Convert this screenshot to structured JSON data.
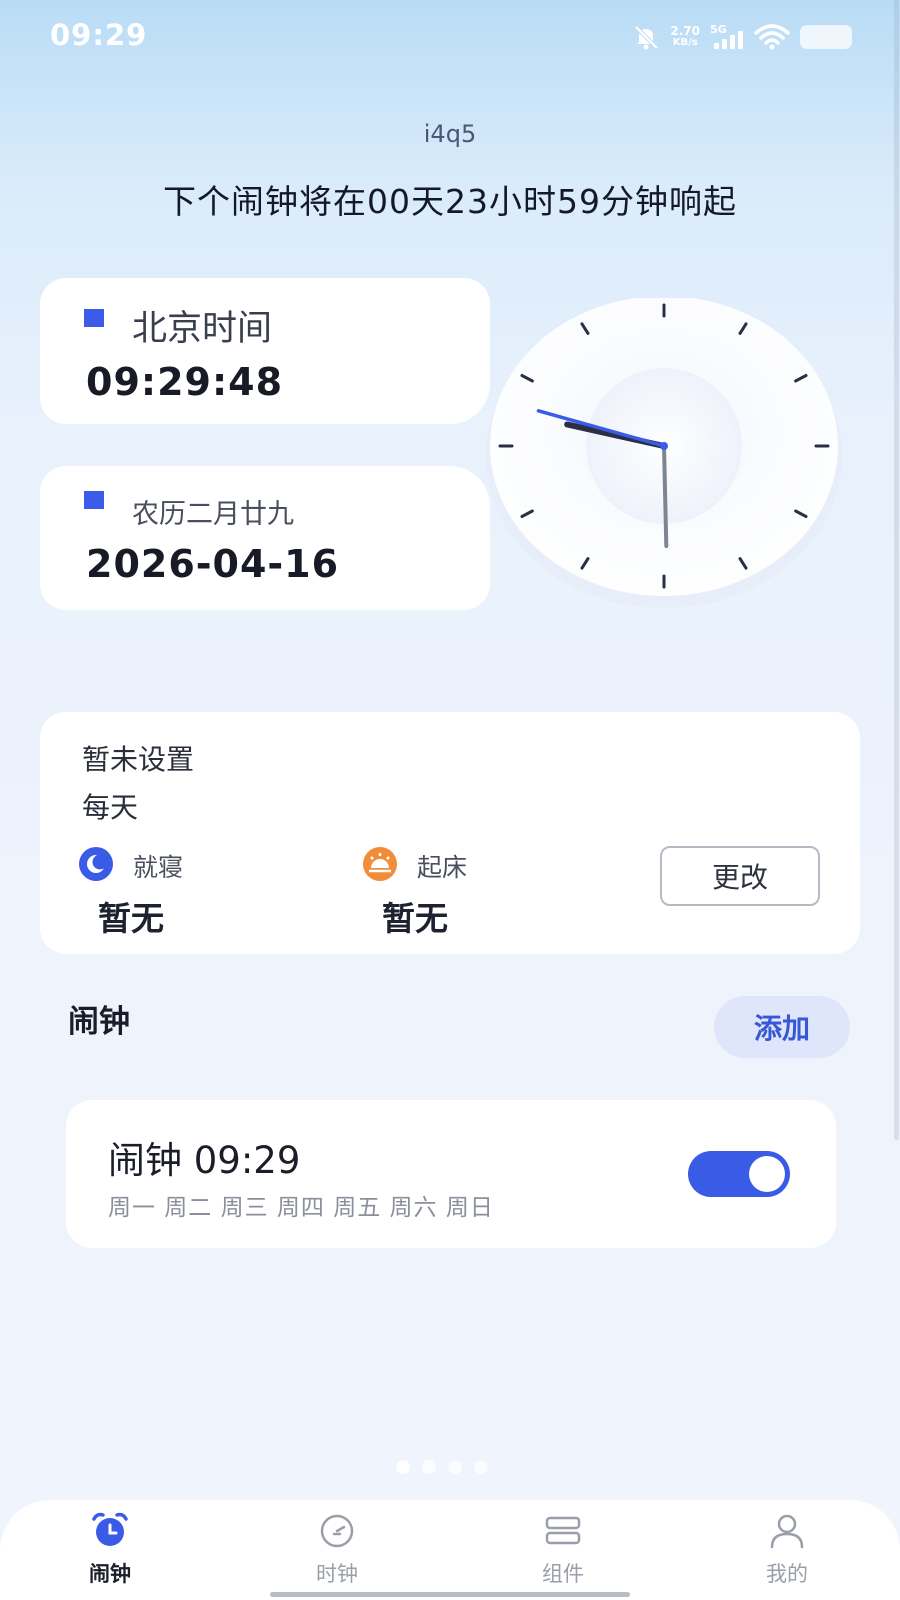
{
  "status_bar": {
    "time": "09:29",
    "net_speed_value": "2.70",
    "net_speed_unit": "KB/s",
    "network_type": "5G",
    "icons": [
      "mute-bell-icon",
      "signal-icon",
      "wifi-icon",
      "battery-icon"
    ]
  },
  "header": {
    "app_id": "i4q5",
    "next_alarm_text": "下个闹钟将在00天23小时59分钟响起"
  },
  "time_card": {
    "label": "北京时间",
    "value": "09:29:48"
  },
  "date_card": {
    "label": "农历二月廿九",
    "value": "2026-04-16"
  },
  "analog_clock": {
    "hours": 9,
    "minutes": 29,
    "seconds": 48
  },
  "sleep_card": {
    "title": "暂未设置",
    "repeat": "每天",
    "bedtime_label": "就寝",
    "bedtime_value": "暂无",
    "wake_label": "起床",
    "wake_value": "暂无",
    "change_button": "更改"
  },
  "alarms_section": {
    "title": "闹钟",
    "add_button": "添加",
    "items": [
      {
        "title": "闹钟 09:29",
        "days": "周一 周二 周三 周四 周五 周六 周日",
        "enabled": true
      }
    ]
  },
  "colors": {
    "accent": "#3a5be6",
    "wake_icon": "#f08c3a"
  },
  "bottom_nav": [
    {
      "label": "闹钟",
      "icon": "alarm-clock-icon",
      "active": true
    },
    {
      "label": "时钟",
      "icon": "clock-icon",
      "active": false
    },
    {
      "label": "组件",
      "icon": "widgets-icon",
      "active": false
    },
    {
      "label": "我的",
      "icon": "profile-icon",
      "active": false
    }
  ]
}
